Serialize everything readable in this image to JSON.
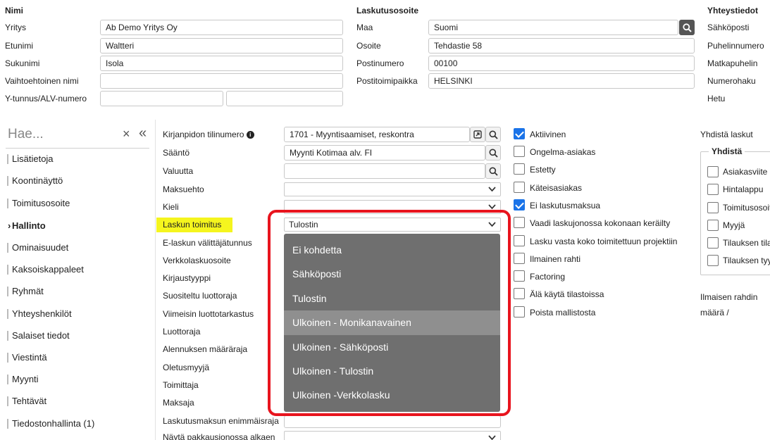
{
  "top": {
    "nimi": {
      "header": "Nimi",
      "fields": [
        {
          "label": "Yritys",
          "value": "Ab Demo Yritys Oy"
        },
        {
          "label": "Etunimi",
          "value": "Waltteri"
        },
        {
          "label": "Sukunimi",
          "value": "Isola"
        },
        {
          "label": "Vaihtoehtoinen nimi",
          "value": ""
        },
        {
          "label": "Y-tunnus/ALV-numero",
          "value": ""
        }
      ]
    },
    "laskutusosoite": {
      "header": "Laskutusosoite",
      "fields": [
        {
          "label": "Maa",
          "value": "Suomi"
        },
        {
          "label": "Osoite",
          "value": "Tehdastie 58"
        },
        {
          "label": "Postinumero",
          "value": "00100"
        },
        {
          "label": "Postitoimipaikka",
          "value": "HELSINKI"
        }
      ]
    },
    "yhteystiedot": {
      "header": "Yhteystiedot",
      "labels": [
        "Sähköposti",
        "Puhelinnumero",
        "Matkapuhelin",
        "Numerohaku",
        "Hetu"
      ]
    }
  },
  "sidebar": {
    "search_placeholder": "Hae...",
    "close_symbol": "×",
    "collapse_symbol": "«",
    "items": [
      {
        "label": "Lisätietoja"
      },
      {
        "label": "Koontinäyttö"
      },
      {
        "label": "Toimitusosoite"
      },
      {
        "label": "Hallinto",
        "active": true
      },
      {
        "label": "Ominaisuudet"
      },
      {
        "label": "Kaksoiskappaleet"
      },
      {
        "label": "Ryhmät"
      },
      {
        "label": "Yhteyshenkilöt"
      },
      {
        "label": "Salaiset tiedot"
      },
      {
        "label": "Viestintä"
      },
      {
        "label": "Myynti"
      },
      {
        "label": "Tehtävät"
      },
      {
        "label": "Tiedostonhallinta (1)"
      }
    ]
  },
  "form": {
    "labels": [
      "Kirjanpidon tilinumero",
      "Sääntö",
      "Valuutta",
      "Maksuehto",
      "Kieli",
      "Laskun toimitus",
      "E-laskun välittäjätunnus",
      "Verkkolaskuosoite",
      "Kirjaustyyppi",
      "Suositeltu luottoraja",
      "Viimeisin luottotarkastus",
      "Luottoraja",
      "Alennuksen määräraja",
      "Oletusmyyjä",
      "Toimittaja",
      "Maksaja",
      "Laskutusmaksun enimmäisraja",
      "Näytä pakkausjonossa alkaen"
    ],
    "tilinumero_value": "1701 - Myyntisaamiset, reskontra",
    "saanto_value": "Myynti Kotimaa alv. FI",
    "valuutta_value": "",
    "maksuehto_value": "",
    "kieli_value": "",
    "laskun_toimitus_value": "Tulostin",
    "info_symbol": "i"
  },
  "dropdown": {
    "options": [
      "Ei kohdetta",
      "Sähköposti",
      "Tulostin",
      "Ulkoinen - Monikanavainen",
      "Ulkoinen - Sähköposti",
      "Ulkoinen - Tulostin",
      "Ulkoinen -Verkkolasku"
    ],
    "highlighted_index": 3
  },
  "checkboxes": [
    {
      "label": "Aktiivinen",
      "checked": true
    },
    {
      "label": "Ongelma-asiakas",
      "checked": false
    },
    {
      "label": "Estetty",
      "checked": false
    },
    {
      "label": "Käteisasiakas",
      "checked": false
    },
    {
      "label": "Ei laskutusmaksua",
      "checked": true
    },
    {
      "label": "Vaadi laskujonossa kokonaan keräilty",
      "checked": false
    },
    {
      "label": "Lasku vasta koko toimitettuun projektiin",
      "checked": false
    },
    {
      "label": "Ilmainen rahti",
      "checked": false
    },
    {
      "label": "Factoring",
      "checked": false
    },
    {
      "label": "Älä käytä tilastoissa",
      "checked": false
    },
    {
      "label": "Poista mallistosta",
      "checked": false
    }
  ],
  "right": {
    "yhdista_laskut": "Yhdistä laskut",
    "group_title": "Yhdistä",
    "group_items": [
      "Asiakasviite",
      "Hintalappu",
      "Toimitusosoite",
      "Myyjä",
      "Tilauksen tila",
      "Tilauksen tyyppi"
    ],
    "ilmaisen_rahdin_label_1": "Ilmaisen rahdin",
    "ilmaisen_rahdin_label_2": "määrä /"
  },
  "colors": {
    "highlight_label_bg": "#f5f51e",
    "dropdown_bg": "#6f6f6f",
    "dropdown_hl": "#8f8f8f",
    "annotation_red": "#e8141e",
    "checkbox_blue": "#1a73e8"
  }
}
